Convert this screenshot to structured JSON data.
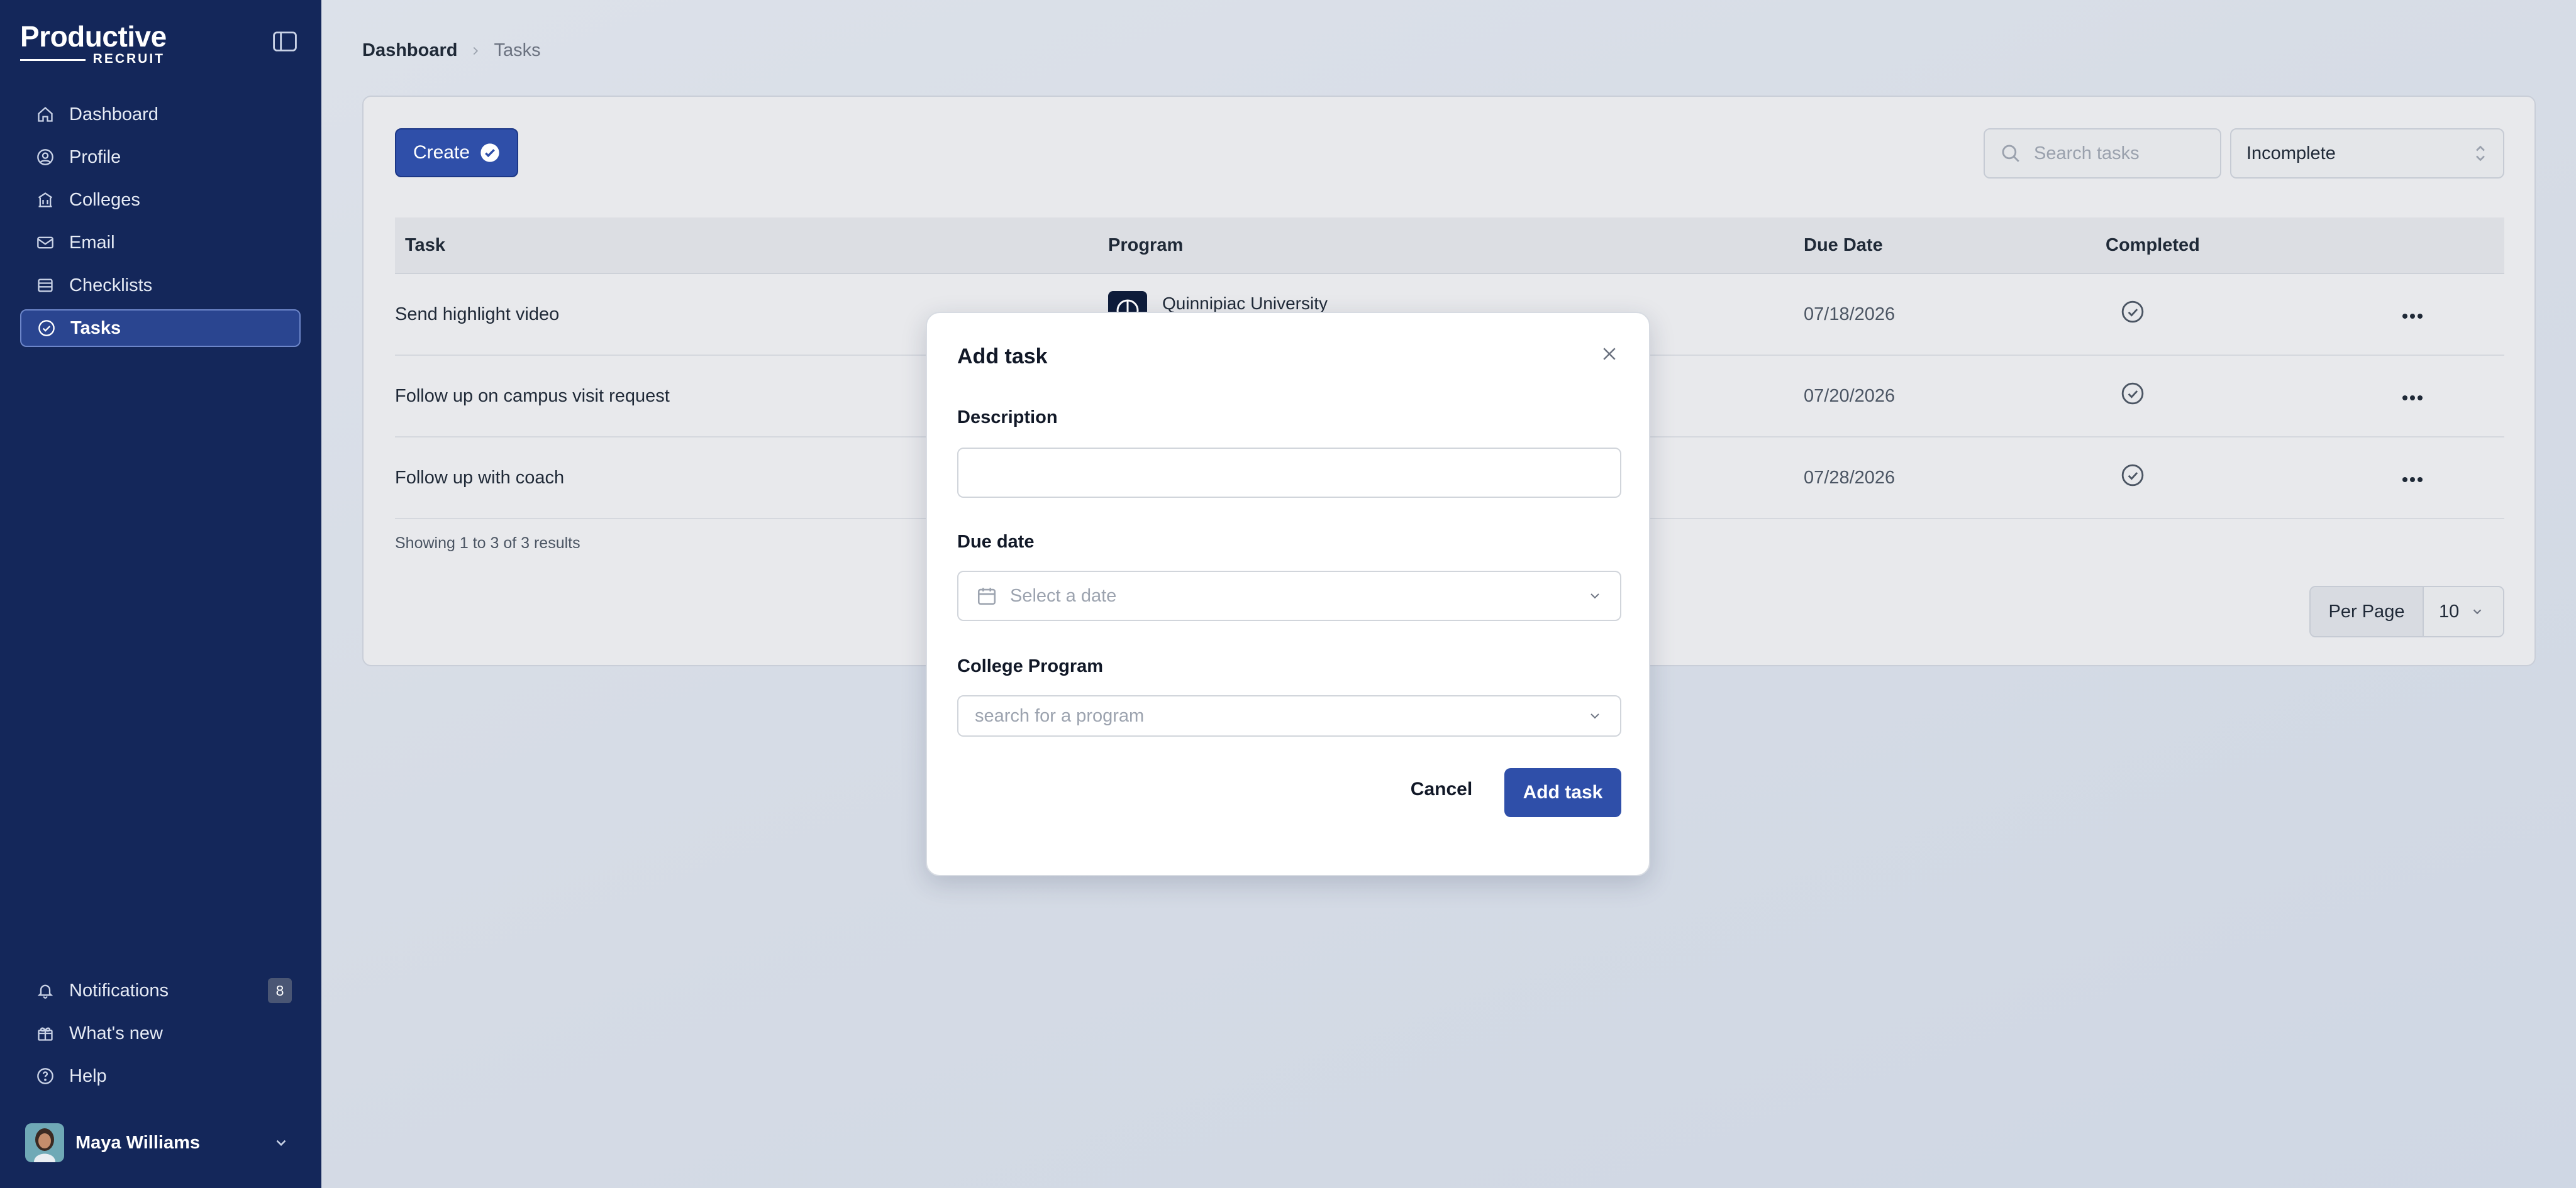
{
  "brand": {
    "name_main": "Productive",
    "name_sub": "RECRUIT"
  },
  "sidebar": {
    "items": [
      {
        "label": "Dashboard",
        "icon": "home-icon"
      },
      {
        "label": "Profile",
        "icon": "user-circle-icon"
      },
      {
        "label": "Colleges",
        "icon": "building-icon"
      },
      {
        "label": "Email",
        "icon": "mail-icon"
      },
      {
        "label": "Checklists",
        "icon": "list-icon"
      },
      {
        "label": "Tasks",
        "icon": "check-circle-icon",
        "active": true
      }
    ],
    "bottom_items": [
      {
        "label": "Notifications",
        "icon": "bell-icon",
        "badge": "8"
      },
      {
        "label": "What's new",
        "icon": "gift-icon"
      },
      {
        "label": "Help",
        "icon": "help-circle-icon"
      }
    ],
    "user": {
      "name": "Maya Williams"
    }
  },
  "breadcrumb": {
    "home": "Dashboard",
    "current": "Tasks"
  },
  "toolbar": {
    "create_label": "Create",
    "search_placeholder": "Search tasks",
    "status_filter": "Incomplete"
  },
  "table": {
    "columns": {
      "task": "Task",
      "program": "Program",
      "due_date": "Due Date",
      "completed": "Completed"
    },
    "rows": [
      {
        "task": "Send highlight video",
        "program": "Quinnipiac University",
        "due_date": "07/18/2026"
      },
      {
        "task": "Follow up on campus visit request",
        "program": "",
        "due_date": "07/20/2026"
      },
      {
        "task": "Follow up with coach",
        "program": "",
        "due_date": "07/28/2026"
      }
    ],
    "results_text": "Showing 1 to 3 of 3 results",
    "per_page_label": "Per Page",
    "per_page_value": "10"
  },
  "modal": {
    "title": "Add task",
    "description_label": "Description",
    "description_value": "",
    "due_date_label": "Due date",
    "due_date_placeholder": "Select a date",
    "program_label": "College Program",
    "program_placeholder": "search for a program",
    "cancel_label": "Cancel",
    "submit_label": "Add task"
  },
  "colors": {
    "sidebar_bg": "#14275a",
    "accent": "#2f4fa9",
    "active_nav": "#2a4590"
  }
}
